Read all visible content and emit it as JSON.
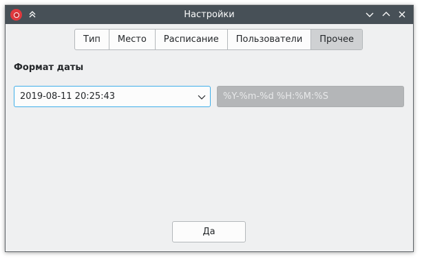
{
  "window": {
    "title": "Настройки"
  },
  "titlebar": {
    "app_icon": "app-logo-icon",
    "keep_above_icon": "double-chevron-up-icon",
    "minimize_icon": "chevron-down-icon",
    "maximize_icon": "chevron-up-icon",
    "close_icon": "close-icon"
  },
  "tabs": [
    {
      "label": "Тип",
      "active": false
    },
    {
      "label": "Место",
      "active": false
    },
    {
      "label": "Расписание",
      "active": false
    },
    {
      "label": "Пользователи",
      "active": false
    },
    {
      "label": "Прочее",
      "active": true
    }
  ],
  "date_format": {
    "label": "Формат даты",
    "selected_value": "2019-08-11 20:25:43",
    "format_string": "%Y-%m-%d %H:%M:%S"
  },
  "footer": {
    "ok_label": "Да"
  },
  "colors": {
    "titlebar": "#475057",
    "focus": "#3daee9",
    "background": "#eff0f1",
    "active_tab": "#cfd1d3"
  }
}
